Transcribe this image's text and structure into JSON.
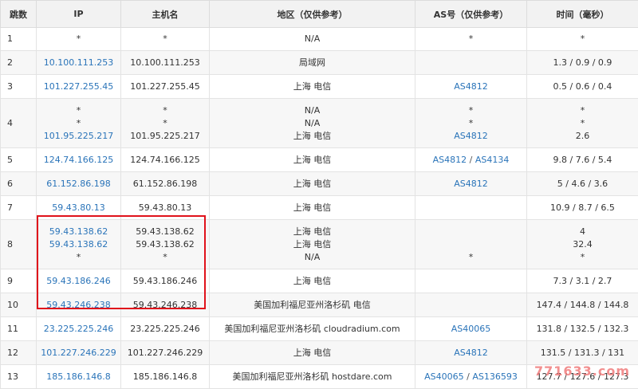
{
  "headers": {
    "hop": "跳数",
    "ip": "IP",
    "host": "主机名",
    "region": "地区（仅供参考）",
    "as": "AS号（仅供参考）",
    "time": "时间（毫秒）"
  },
  "rows": [
    {
      "hop": "1",
      "ip": [
        "*"
      ],
      "host": [
        "*"
      ],
      "region": [
        "N/A"
      ],
      "as": [
        [
          "*"
        ]
      ],
      "time": [
        "*"
      ]
    },
    {
      "hop": "2",
      "ip": [
        "10.100.111.253"
      ],
      "host": [
        "10.100.111.253"
      ],
      "region": [
        "局域网"
      ],
      "as": [
        []
      ],
      "time": [
        "1.3 / 0.9 / 0.9"
      ]
    },
    {
      "hop": "3",
      "ip": [
        "101.227.255.45"
      ],
      "host": [
        "101.227.255.45"
      ],
      "region": [
        "上海 电信"
      ],
      "as": [
        [
          "AS4812"
        ]
      ],
      "time": [
        "0.5 / 0.6 / 0.4"
      ]
    },
    {
      "hop": "4",
      "ip": [
        "*",
        "*",
        "101.95.225.217"
      ],
      "host": [
        "*",
        "*",
        "101.95.225.217"
      ],
      "region": [
        "N/A",
        "N/A",
        "上海 电信"
      ],
      "as": [
        [
          "*"
        ],
        [
          "*"
        ],
        [
          "AS4812"
        ]
      ],
      "time": [
        "*",
        "*",
        "2.6"
      ]
    },
    {
      "hop": "5",
      "ip": [
        "124.74.166.125"
      ],
      "host": [
        "124.74.166.125"
      ],
      "region": [
        "上海 电信"
      ],
      "as": [
        [
          "AS4812",
          "AS4134"
        ]
      ],
      "time": [
        "9.8 / 7.6 / 5.4"
      ]
    },
    {
      "hop": "6",
      "ip": [
        "61.152.86.198"
      ],
      "host": [
        "61.152.86.198"
      ],
      "region": [
        "上海 电信"
      ],
      "as": [
        [
          "AS4812"
        ]
      ],
      "time": [
        "5 / 4.6 / 3.6"
      ]
    },
    {
      "hop": "7",
      "ip": [
        "59.43.80.13"
      ],
      "host": [
        "59.43.80.13"
      ],
      "region": [
        "上海 电信"
      ],
      "as": [
        []
      ],
      "time": [
        "10.9 / 8.7 / 6.5"
      ]
    },
    {
      "hop": "8",
      "ip": [
        "59.43.138.62",
        "59.43.138.62",
        "*"
      ],
      "host": [
        "59.43.138.62",
        "59.43.138.62",
        "*"
      ],
      "region": [
        "上海 电信",
        "上海 电信",
        "N/A"
      ],
      "as": [
        [],
        [],
        [
          "*"
        ]
      ],
      "time": [
        "4",
        "32.4",
        "*"
      ]
    },
    {
      "hop": "9",
      "ip": [
        "59.43.186.246"
      ],
      "host": [
        "59.43.186.246"
      ],
      "region": [
        "上海 电信"
      ],
      "as": [
        []
      ],
      "time": [
        "7.3 / 3.1 / 2.7"
      ]
    },
    {
      "hop": "10",
      "ip": [
        "59.43.246.238"
      ],
      "host": [
        "59.43.246.238"
      ],
      "region": [
        "美国加利福尼亚州洛杉矶 电信"
      ],
      "as": [
        []
      ],
      "time": [
        "147.4 / 144.8 / 144.8"
      ]
    },
    {
      "hop": "11",
      "ip": [
        "23.225.225.246"
      ],
      "host": [
        "23.225.225.246"
      ],
      "region": [
        "美国加利福尼亚州洛杉矶 cloudradium.com"
      ],
      "as": [
        [
          "AS40065"
        ]
      ],
      "time": [
        "131.8 / 132.5 / 132.3"
      ]
    },
    {
      "hop": "12",
      "ip": [
        "101.227.246.229"
      ],
      "host": [
        "101.227.246.229"
      ],
      "region": [
        "上海 电信"
      ],
      "as": [
        [
          "AS4812"
        ]
      ],
      "time": [
        "131.5 / 131.3 / 131"
      ]
    },
    {
      "hop": "13",
      "ip": [
        "185.186.146.8"
      ],
      "host": [
        "185.186.146.8"
      ],
      "region": [
        "美国加利福尼亚州洛杉矶 hostdare.com"
      ],
      "as": [
        [
          "AS40065",
          "AS136593"
        ]
      ],
      "time": [
        "127.7 / 127.6 / 127.3"
      ]
    }
  ],
  "watermark": "771633.com",
  "colors": {
    "link": "#2a74b9",
    "highlight": "#e0121b",
    "header_bg": "#f2f2f2"
  }
}
